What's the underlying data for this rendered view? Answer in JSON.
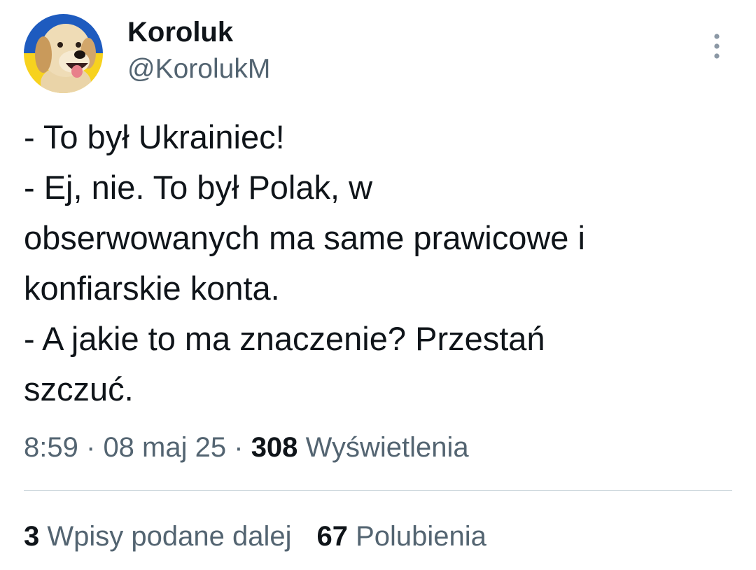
{
  "author": {
    "display_name": "Koroluk",
    "handle": "@KorolukM",
    "avatar_icon": "dog-avatar-icon"
  },
  "more_icon": "more-vertical-icon",
  "tweet": {
    "lines": [
      "- To był Ukrainiec!",
      "- Ej, nie. To był Polak, w",
      "obserwowanych ma same prawicowe i",
      "konfiarskie konta.",
      "- A jakie to ma znaczenie? Przestań",
      "szczuć."
    ]
  },
  "meta": {
    "time": "8:59",
    "separator": "·",
    "date": "08 maj 25",
    "views_count": "308",
    "views_label": "Wyświetlenia"
  },
  "stats": {
    "reposts_count": "3",
    "reposts_label": "Wpisy podane dalej",
    "likes_count": "67",
    "likes_label": "Polubienia"
  },
  "colors": {
    "text_primary": "#0f1419",
    "text_secondary": "#536471",
    "divider": "#cfd9de",
    "avatar_flag_blue": "#1e5bbf",
    "avatar_flag_yellow": "#f7d21e"
  }
}
